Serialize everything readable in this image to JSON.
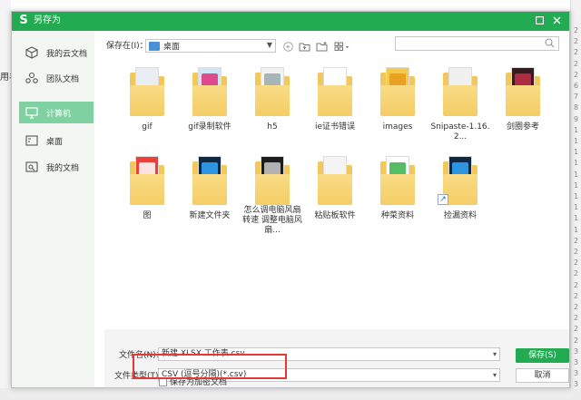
{
  "background": {
    "left_text": "用羊",
    "right_numbers": [
      "2",
      "2",
      "2",
      "2",
      "2",
      "6",
      "7",
      "8",
      "9",
      "1",
      "1",
      "1",
      "1",
      "1",
      "1",
      "1",
      "1",
      "1",
      "1",
      "2",
      "2",
      "2",
      "2",
      "2",
      "2",
      "2",
      "2",
      "2",
      "2",
      "3",
      "3",
      "3",
      "3"
    ]
  },
  "titlebar": {
    "title": "另存为",
    "logo_letter": "S"
  },
  "sidebar": {
    "items": [
      {
        "label": "我的云文档",
        "icon": "cube-icon"
      },
      {
        "label": "团队文档",
        "icon": "team-icon"
      },
      {
        "label": "计算机",
        "icon": "monitor-icon"
      },
      {
        "label": "桌面",
        "icon": "desktop-icon"
      },
      {
        "label": "我的文档",
        "icon": "documents-icon"
      }
    ],
    "active_index": 2
  },
  "toolbar": {
    "save_in_label": "保存在(I)：",
    "location": "桌面",
    "search_placeholder": ""
  },
  "files": [
    {
      "name": "gif",
      "type": "folder",
      "doc": "#e9eef5"
    },
    {
      "name": "gif录制软件",
      "type": "folder",
      "doc": "#cfe6f7",
      "accent": "#e0307a"
    },
    {
      "name": "h5",
      "type": "folder",
      "doc": "#f2f2f2",
      "accent": "#9aa"
    },
    {
      "name": "ie证书错误",
      "type": "folder",
      "doc": "#ffffff"
    },
    {
      "name": "images",
      "type": "folder",
      "doc": "#f5c94a",
      "accent": "#e89a1a"
    },
    {
      "name": "Snipaste-1.16.2...",
      "type": "folder",
      "doc": "#f0f0f0"
    },
    {
      "name": "剑圈参考",
      "type": "folder",
      "doc": "#3a1a1f",
      "accent": "#c0304a"
    },
    {
      "name": "图",
      "type": "folder",
      "doc": "#e9413a",
      "accent": "#fff"
    },
    {
      "name": "新建文件夹",
      "type": "folder",
      "doc": "#0c2a45",
      "accent": "#31a8ff"
    },
    {
      "name": "怎么调电脑风扇转速 调整电脑风扇...",
      "type": "folder",
      "doc": "#1e1e1e",
      "accent": "#ccc"
    },
    {
      "name": "粘贴板软件",
      "type": "folder",
      "doc": "#f4f4f4"
    },
    {
      "name": "种菜资料",
      "type": "folder",
      "doc": "#ffffff",
      "accent": "#36b24a"
    },
    {
      "name": "捡漏资料",
      "type": "folder",
      "doc": "#0c2a45",
      "accent": "#31a8ff",
      "shortcut": true
    }
  ],
  "bottom": {
    "filename_label": "文件名(N)：",
    "filename_value": "新建 XLSX 工作表.csv",
    "filetype_label": "文件类型(T)：",
    "filetype_value": "CSV (逗号分隔)(*.csv)",
    "save_button": "保存(S)",
    "cancel_button": "取消",
    "encrypt_label": "保存为加密文档"
  },
  "colors": {
    "brand_green": "#23ab52",
    "sidebar_active": "#7fd1a2",
    "highlight_red": "#e53935",
    "folder_yellow": "#f2c85b"
  }
}
